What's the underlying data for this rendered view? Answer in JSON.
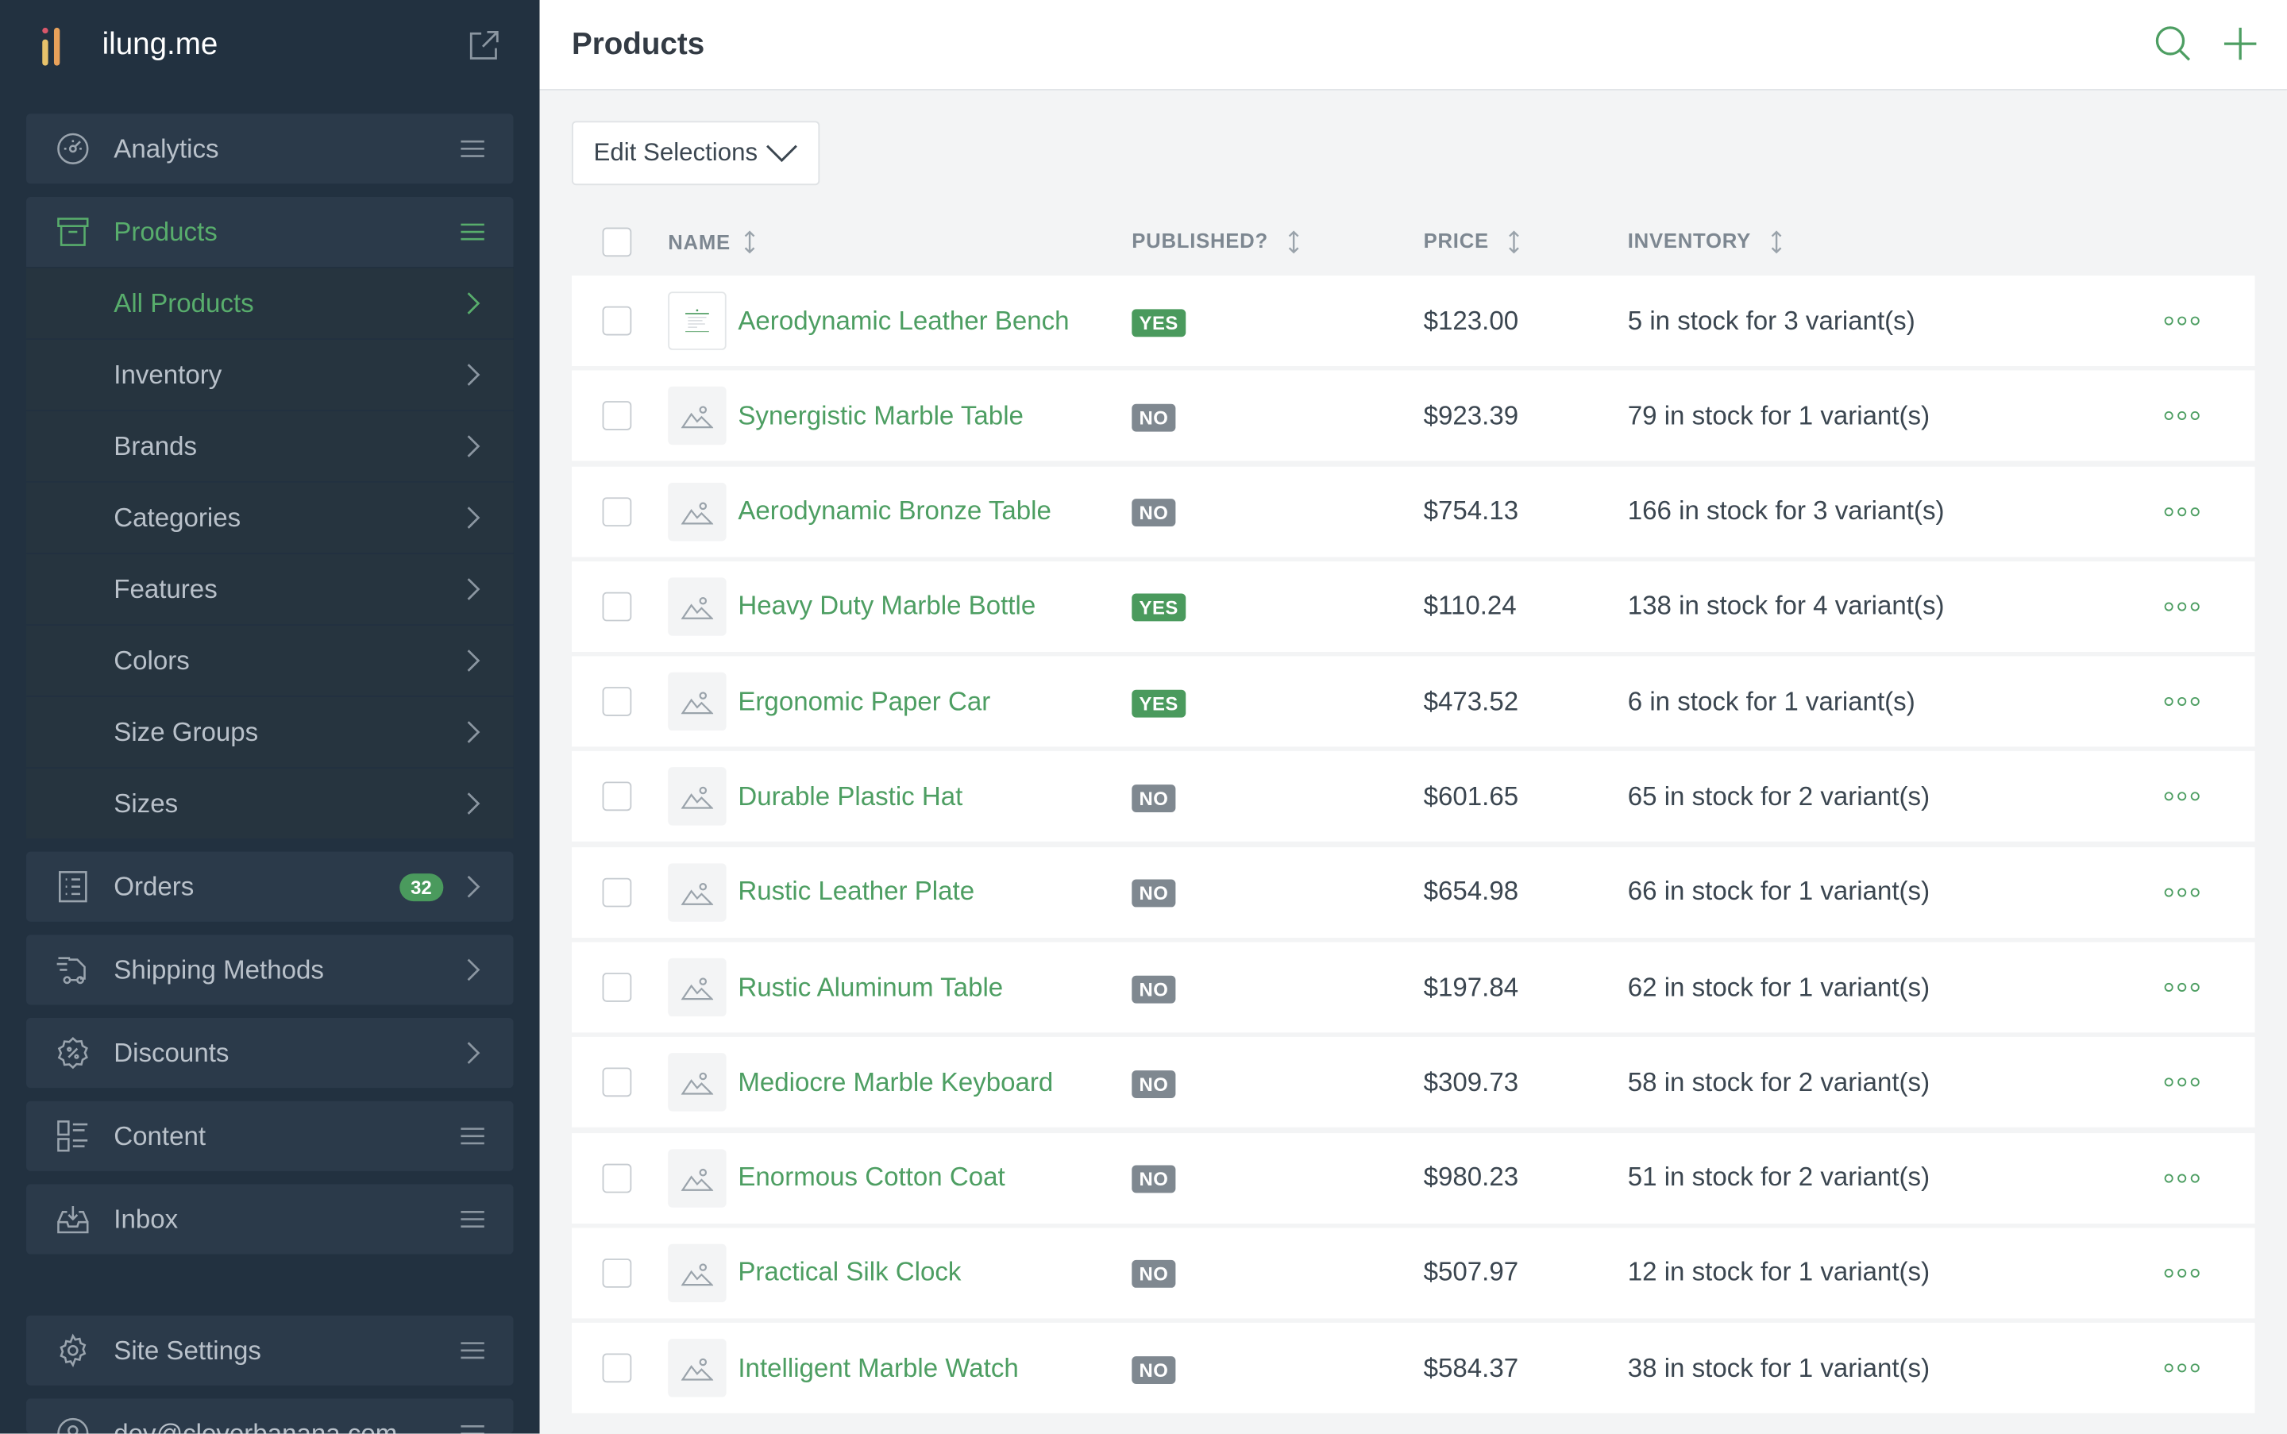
{
  "app": {
    "name": "ilung.me",
    "page_title": "Products"
  },
  "sidebar": {
    "groups": [
      {
        "label": "Analytics",
        "icon": "analytics-gauge-icon",
        "trail": "menu-lines-icon"
      },
      {
        "label": "Products",
        "icon": "archive-box-icon",
        "trail": "menu-lines-icon",
        "active": true,
        "children": [
          {
            "label": "All Products",
            "active": true
          },
          {
            "label": "Inventory"
          },
          {
            "label": "Brands"
          },
          {
            "label": "Categories"
          },
          {
            "label": "Features"
          },
          {
            "label": "Colors"
          },
          {
            "label": "Size Groups"
          },
          {
            "label": "Sizes"
          }
        ]
      },
      {
        "label": "Orders",
        "icon": "checklist-icon",
        "badge": "32",
        "trail": "chevron-right-icon"
      },
      {
        "label": "Shipping Methods",
        "icon": "shipping-icon",
        "trail": "chevron-right-icon"
      },
      {
        "label": "Discounts",
        "icon": "discount-badge-icon",
        "trail": "chevron-right-icon"
      },
      {
        "label": "Content",
        "icon": "content-layout-icon",
        "trail": "menu-lines-icon"
      },
      {
        "label": "Inbox",
        "icon": "inbox-tray-icon",
        "trail": "menu-lines-icon"
      }
    ],
    "footer": [
      {
        "label": "Site Settings",
        "icon": "gear-icon"
      },
      {
        "label": "dev@cleverbanana.com",
        "icon": "user-icon"
      }
    ]
  },
  "toolbar": {
    "edit_selections": "Edit Selections"
  },
  "table": {
    "columns": {
      "name": "NAME",
      "published": "PUBLISHED?",
      "price": "PRICE",
      "inventory": "INVENTORY"
    },
    "rows": [
      {
        "name": "Aerodynamic Leather Bench",
        "published": "YES",
        "price": "$123.00",
        "inventory": "5 in stock for 3 variant(s)",
        "has_image": true
      },
      {
        "name": "Synergistic Marble Table",
        "published": "NO",
        "price": "$923.39",
        "inventory": "79 in stock for 1 variant(s)"
      },
      {
        "name": "Aerodynamic Bronze Table",
        "published": "NO",
        "price": "$754.13",
        "inventory": "166 in stock for 3 variant(s)"
      },
      {
        "name": "Heavy Duty Marble Bottle",
        "published": "YES",
        "price": "$110.24",
        "inventory": "138 in stock for 4 variant(s)"
      },
      {
        "name": "Ergonomic Paper Car",
        "published": "YES",
        "price": "$473.52",
        "inventory": "6 in stock for 1 variant(s)"
      },
      {
        "name": "Durable Plastic Hat",
        "published": "NO",
        "price": "$601.65",
        "inventory": "65 in stock for 2 variant(s)"
      },
      {
        "name": "Rustic Leather Plate",
        "published": "NO",
        "price": "$654.98",
        "inventory": "66 in stock for 1 variant(s)"
      },
      {
        "name": "Rustic Aluminum Table",
        "published": "NO",
        "price": "$197.84",
        "inventory": "62 in stock for 1 variant(s)"
      },
      {
        "name": "Mediocre Marble Keyboard",
        "published": "NO",
        "price": "$309.73",
        "inventory": "58 in stock for 2 variant(s)"
      },
      {
        "name": "Enormous Cotton Coat",
        "published": "NO",
        "price": "$980.23",
        "inventory": "51 in stock for 2 variant(s)"
      },
      {
        "name": "Practical Silk Clock",
        "published": "NO",
        "price": "$507.97",
        "inventory": "12 in stock for 1 variant(s)"
      },
      {
        "name": "Intelligent Marble Watch",
        "published": "NO",
        "price": "$584.37",
        "inventory": "38 in stock for 1 variant(s)"
      }
    ]
  },
  "colors": {
    "sidebar_bg": "#223140",
    "accent_green": "#4d9e62",
    "yes_badge": "#4a9a5d",
    "no_badge": "#7f8890"
  }
}
